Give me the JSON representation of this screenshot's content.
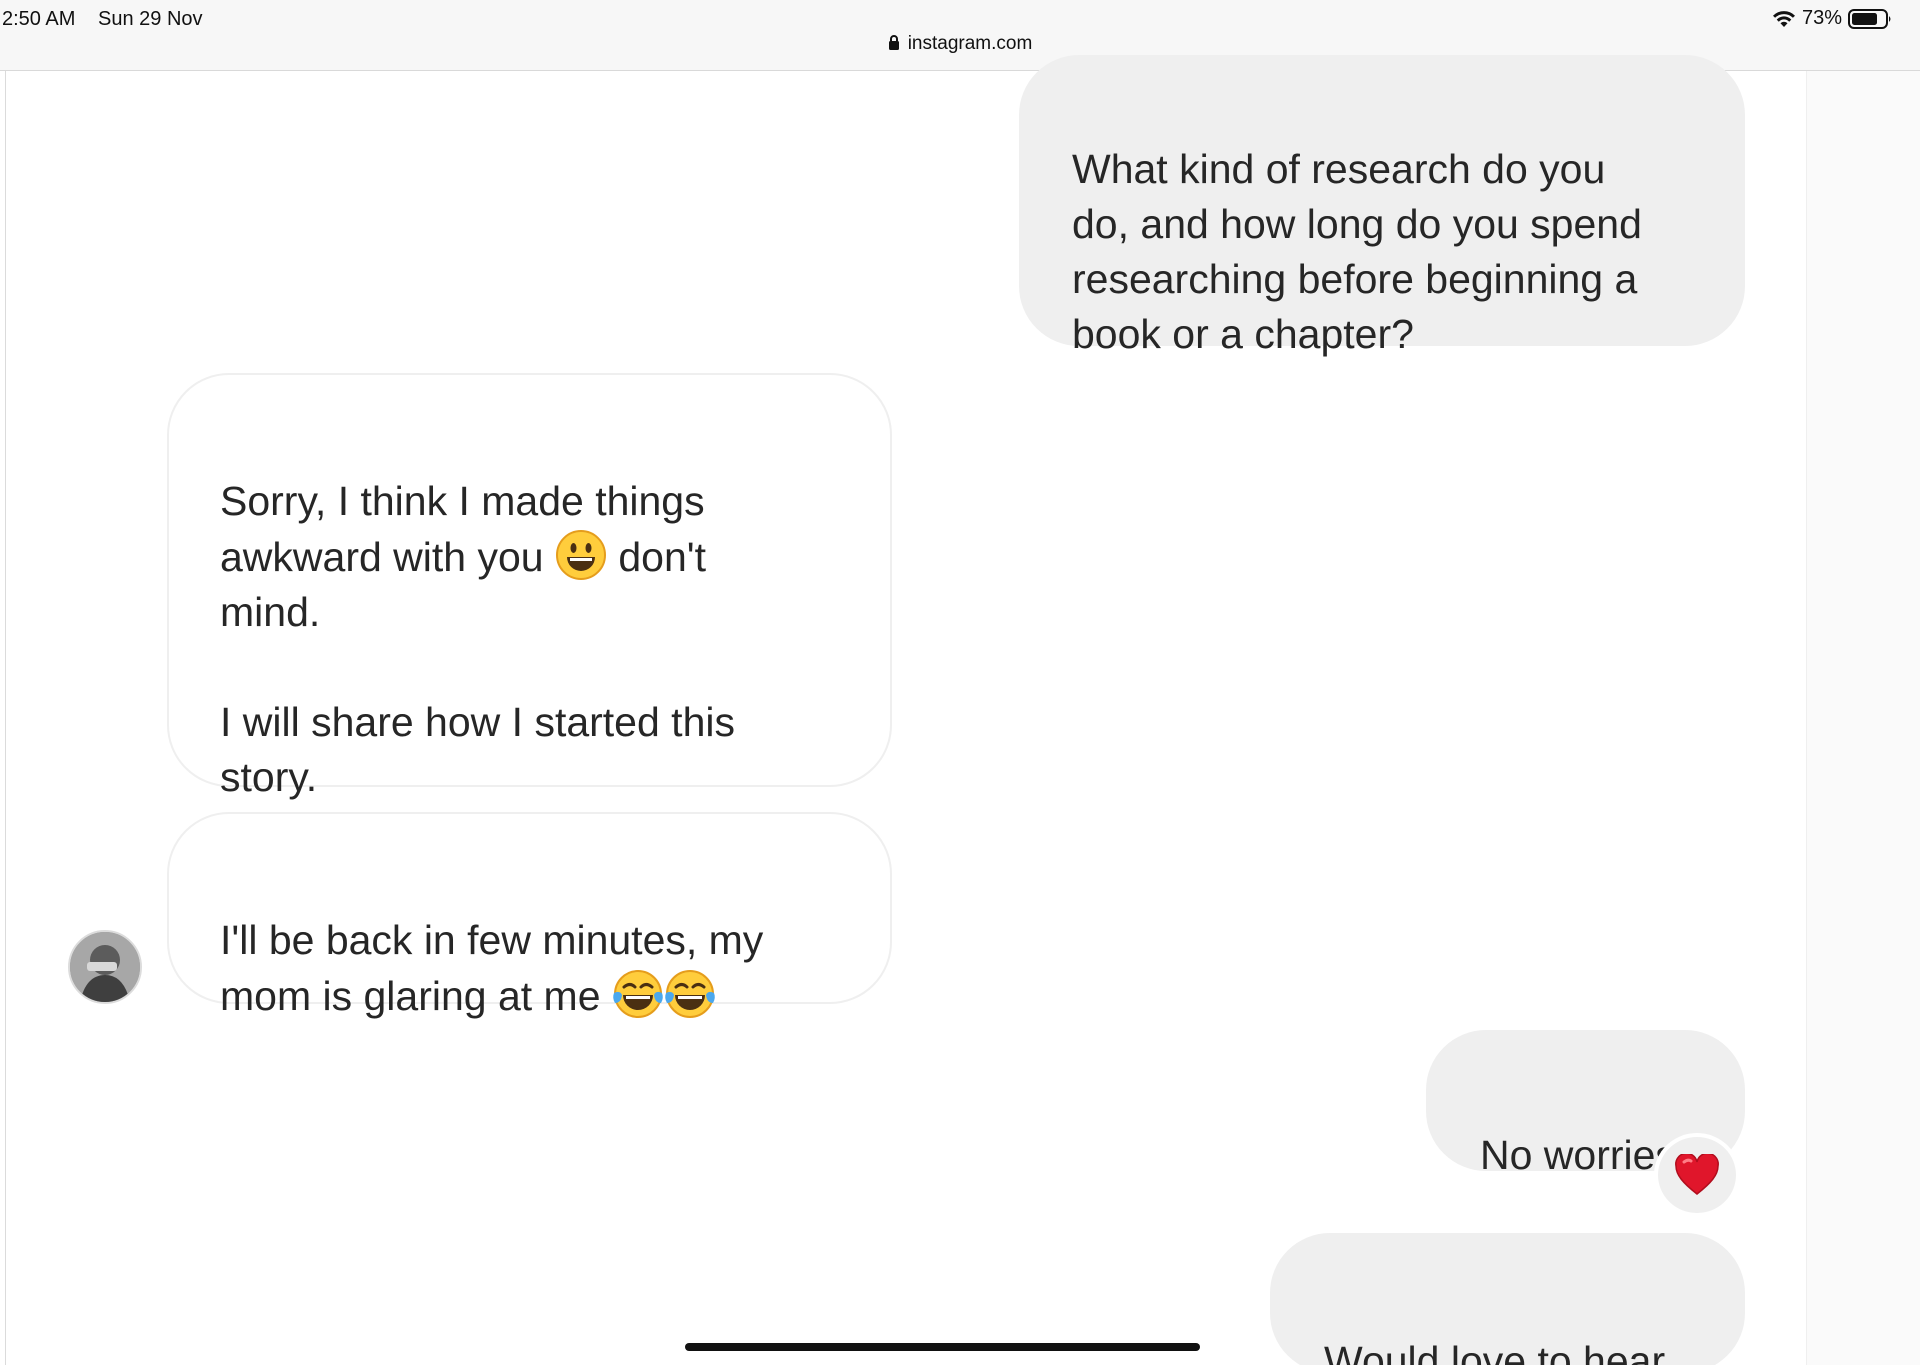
{
  "status_bar": {
    "time": "2:50 AM",
    "date": "Sun 29 Nov",
    "battery": "73%",
    "battery_level": 0.73
  },
  "address_bar": {
    "url": "instagram.com"
  },
  "messages": [
    {
      "direction": "sent",
      "text": "What kind of research do you\ndo, and how long do you spend\nresearching before beginning a\nbook or a chapter?"
    },
    {
      "direction": "received",
      "text_before_emoji": "Sorry, I think I made things\nawkward with you ",
      "emoji": "grinning-face",
      "text_after_emoji": " don't\nmind.\n\nI will share how I started this\nstory."
    },
    {
      "direction": "received",
      "text_before_emoji": "I'll be back in few minutes, my\nmom is glaring at me ",
      "emoji": "face-with-tears-of-joy",
      "emoji_count": 2
    },
    {
      "direction": "sent",
      "text": "No worries",
      "reaction": "red-heart"
    },
    {
      "direction": "sent",
      "text": "Would love to hear"
    }
  ],
  "colors": {
    "sent_bubble": "#efefef",
    "received_border": "#efefef",
    "text": "#262626",
    "heart": "#e0162b",
    "emoji_yellow": "#ffcd3c"
  }
}
